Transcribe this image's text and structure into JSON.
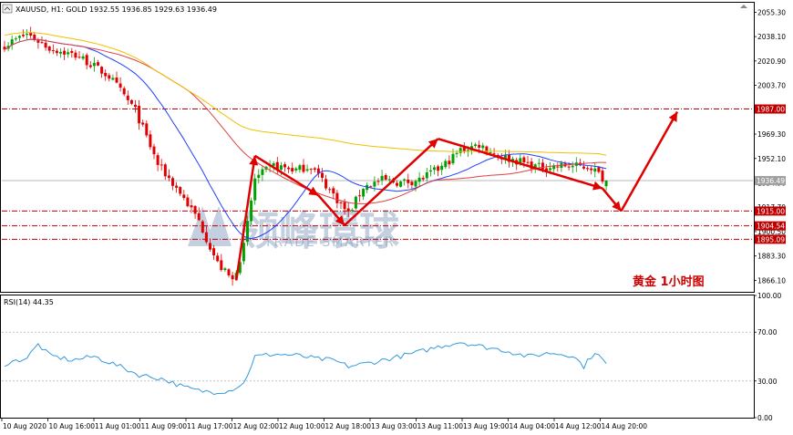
{
  "window": {
    "title": "XAUUSD, H1:  GOLD  1932.55 1936.85 1929.63 1936.49",
    "rsi_title": "RSI(14) 44.35"
  },
  "annotation": {
    "note": "黄金 1小时图"
  },
  "watermark": {
    "brand": "领峰環球",
    "sub": "TRADE SMARTER"
  },
  "colors": {
    "bull": "#00a000",
    "bear": "#e00000",
    "ma_fast": "#2040ff",
    "ma_mid": "#e04040",
    "ma_slow": "#f0c000",
    "rsi": "#3399dd",
    "arrow": "#e00000",
    "level": "#c00000",
    "current": "#a0a0a0"
  },
  "chart_data": [
    {
      "type": "candlestick",
      "symbol": "XAUUSD",
      "timeframe": "H1",
      "ohlc_header": {
        "open": 1932.55,
        "high": 1936.85,
        "low": 1929.63,
        "close": 1936.49
      },
      "ylim": [
        1858,
        2062
      ],
      "y_ticks": [
        "2055.30",
        "2038.10",
        "2020.90",
        "2003.70",
        "1986.50",
        "1969.30",
        "1952.10",
        "1934.90",
        "1917.70",
        "1900.50",
        "1883.30",
        "1866.10"
      ],
      "x_ticks": [
        "10 Aug 2020",
        "10 Aug 16:00",
        "11 Aug 01:00",
        "11 Aug 09:00",
        "11 Aug 17:00",
        "12 Aug 02:00",
        "12 Aug 10:00",
        "12 Aug 18:00",
        "13 Aug 03:00",
        "13 Aug 11:00",
        "13 Aug 19:00",
        "14 Aug 04:00",
        "14 Aug 12:00",
        "14 Aug 20:00"
      ],
      "price_levels": [
        {
          "label": "1987.00",
          "value": 1987.0,
          "style": "dash-dot"
        },
        {
          "label": "1936.49",
          "value": 1936.49,
          "style": "current"
        },
        {
          "label": "1915.00",
          "value": 1915.0,
          "style": "dash-dot"
        },
        {
          "label": "1904.54",
          "value": 1904.54,
          "style": "dash-dot"
        },
        {
          "label": "1895.09",
          "value": 1895.09,
          "style": "dash-dot"
        }
      ],
      "anchors": [
        [
          0,
          2032
        ],
        [
          6,
          2040
        ],
        [
          12,
          2030
        ],
        [
          20,
          2024
        ],
        [
          28,
          2010
        ],
        [
          35,
          1986
        ],
        [
          41,
          1948
        ],
        [
          47,
          1928
        ],
        [
          52,
          1908
        ],
        [
          57,
          1878
        ],
        [
          61,
          1866
        ],
        [
          64,
          1890
        ],
        [
          67,
          1938
        ],
        [
          72,
          1947
        ],
        [
          78,
          1944
        ],
        [
          82,
          1947
        ],
        [
          87,
          1930
        ],
        [
          92,
          1913
        ],
        [
          96,
          1932
        ],
        [
          101,
          1937
        ],
        [
          106,
          1935
        ],
        [
          111,
          1937
        ],
        [
          117,
          1946
        ],
        [
          122,
          1958
        ],
        [
          127,
          1962
        ],
        [
          132,
          1954
        ],
        [
          138,
          1950
        ],
        [
          143,
          1946
        ],
        [
          150,
          1947
        ],
        [
          157,
          1946
        ],
        [
          161,
          1936
        ]
      ],
      "bars": 162,
      "ma": [
        {
          "name": "",
          "period": 20,
          "color": "#2040ff"
        },
        {
          "name": "",
          "period": 50,
          "color": "#e04040"
        },
        {
          "name": "",
          "period": 160,
          "color": "#f0c000"
        }
      ],
      "arrows": [
        [
          [
            62,
            1866
          ],
          [
            67,
            1954
          ]
        ],
        [
          [
            67,
            1954
          ],
          [
            84,
            1926
          ]
        ],
        [
          [
            84,
            1926
          ],
          [
            91,
            1905
          ]
        ],
        [
          [
            91,
            1905
          ],
          [
            116,
            1966
          ]
        ],
        [
          [
            116,
            1966
          ],
          [
            160,
            1931
          ]
        ],
        [
          [
            160,
            1931
          ],
          [
            165,
            1915
          ]
        ],
        [
          [
            165,
            1915
          ],
          [
            180,
            1985
          ]
        ]
      ]
    },
    {
      "type": "line",
      "name": "RSI(14)",
      "value": 44.35,
      "ylim": [
        0,
        100
      ],
      "y_ticks": [
        "100.00",
        "70.00",
        "30.00",
        "0.00"
      ],
      "levels": [
        70,
        30
      ],
      "x": [
        0,
        6,
        9,
        12,
        18,
        24,
        30,
        36,
        42,
        48,
        52,
        56,
        60,
        64,
        67,
        72,
        78,
        84,
        88,
        92,
        98,
        104,
        110,
        116,
        122,
        128,
        134,
        140,
        146,
        152,
        155,
        158,
        161
      ],
      "values": [
        44,
        49,
        60,
        51,
        47,
        50,
        43,
        35,
        32,
        25,
        22,
        21,
        22,
        28,
        50,
        52,
        51,
        48,
        47,
        42,
        45,
        49,
        53,
        58,
        62,
        58,
        55,
        50,
        53,
        51,
        42,
        54,
        44
      ]
    }
  ]
}
